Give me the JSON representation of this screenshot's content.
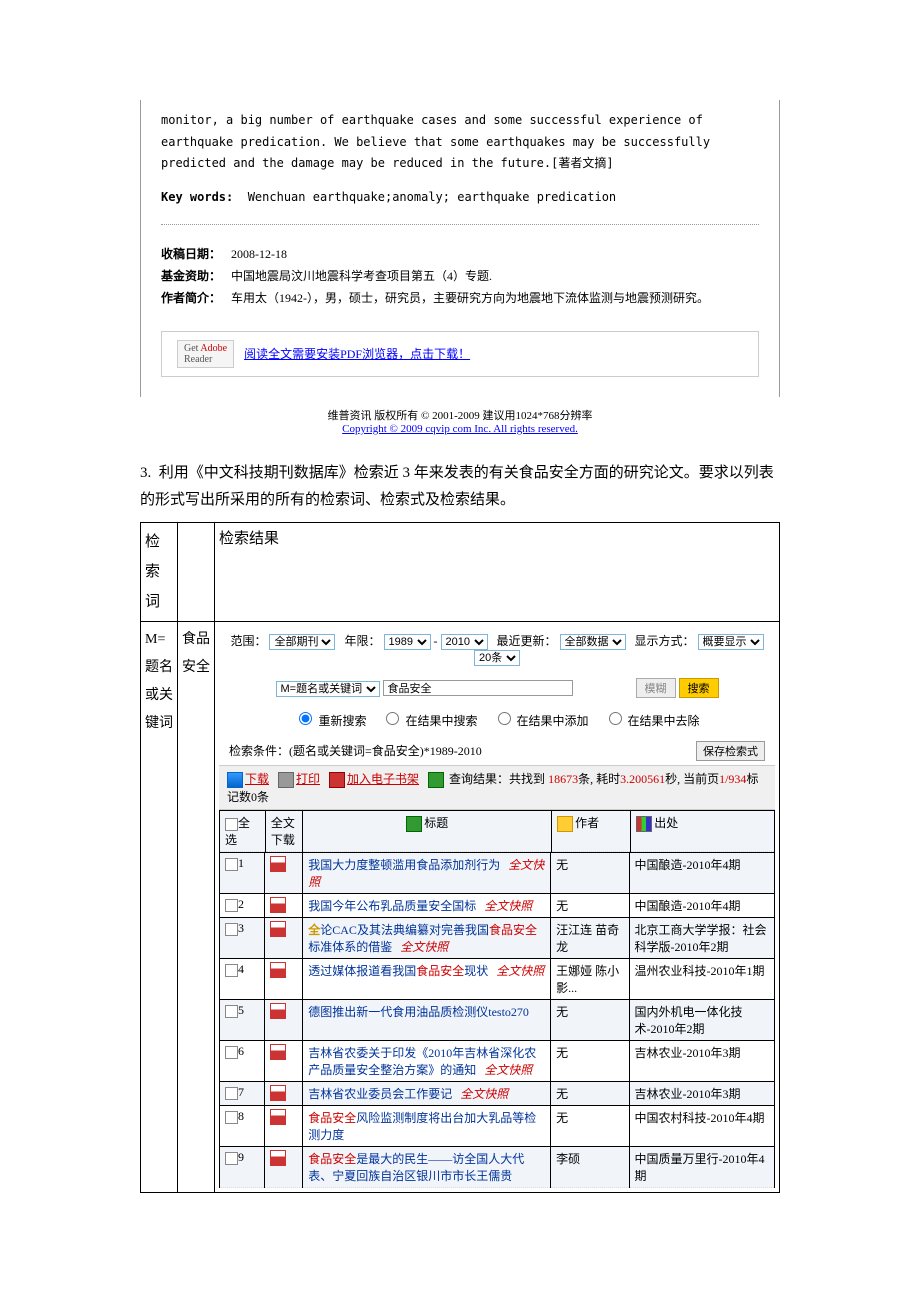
{
  "abstract": "monitor, a big number of earthquake cases and some successful experience of earthquake predication. We believe that some earthquakes may be successfully predicted and the damage may be reduced in the future.[著者文摘]",
  "kw_label": "Key words:",
  "kw_value": "Wenchuan earthquake;anomaly; earthquake predication",
  "meta": {
    "date_label": "收稿日期：",
    "date_value": "2008-12-18",
    "fund_label": "基金资助：",
    "fund_value": "中国地震局汶川地震科学考查项目第五（4）专题.",
    "author_label": "作者简介：",
    "author_value": "车用太（1942-），男，硕士，研究员，主要研究方向为地震地下流体监测与地震预测研究。"
  },
  "reader": {
    "badge_prefix": "Get ",
    "badge_brand": "Adobe",
    "badge_suffix": "Reader",
    "link": "阅读全文需要安装PDF浏览器，点击下载！"
  },
  "footer": {
    "l1": "维普资讯 版权所有 © 2001-2009 建议用1024*768分辨率",
    "l2": "Copyright © 2009 cqvip com Inc. All rights reserved."
  },
  "question": {
    "num": "3.",
    "text": "利用《中文科技期刊数据库》检索近 3 年来发表的有关食品安全方面的研究论文。要求以列表的形式写出所采用的所有的检索词、检索式及检索结果。"
  },
  "tbl": {
    "h1": "检索词",
    "h2": "",
    "h3": "检索结果",
    "r1c1": "M=题名或关键词",
    "r1c2": "食品安全"
  },
  "controls": {
    "range_lbl": "范围：",
    "range_val": "全部期刊",
    "year_lbl": "年限：",
    "year_from": "1989",
    "year_to": "2010",
    "update_lbl": "最近更新：",
    "update_val": "全部数据",
    "display_lbl": "显示方式：",
    "display_val": "概要显示",
    "per_page": "20条",
    "field_val": "M=题名或关键词",
    "kw_val": "食品安全",
    "fuzzy": "模糊",
    "search": "搜索",
    "r1": "重新搜索",
    "r2": "在结果中搜索",
    "r3": "在结果中添加",
    "r4": "在结果中去除",
    "cond_lbl": "检索条件：",
    "cond_val": "(题名或关键词=食品安全)*1989-2010",
    "save": "保存检索式"
  },
  "bar": {
    "download": "下载",
    "print": "打印",
    "shelf": "加入电子书架",
    "res_pre": "查询结果：共找到 ",
    "res_count": "18673",
    "res_mid1": "条, 耗时",
    "res_time": "3.200561",
    "res_mid2": "秒, 当前页",
    "res_page": "1/934",
    "res_sel": "标记数0条"
  },
  "cols": {
    "all": "全选",
    "full": "全文下载",
    "title": "标题",
    "author": "作者",
    "source": "出处"
  },
  "rows": [
    {
      "n": "1",
      "title_pre": "我国大力度整顿滥用食品添加剂行为",
      "kw": "",
      "qw": "全文快照",
      "auth": "无",
      "src": "中国酿造-2010年4期"
    },
    {
      "n": "2",
      "title_pre": "我国今年公布乳品质量安全国标",
      "kw": "",
      "qw": "全文快照",
      "auth": "无",
      "src": "中国酿造-2010年4期"
    },
    {
      "n": "3",
      "title_pre": "论CAC及其法典编纂对完善我国",
      "kw": "食品安全",
      "title_post": "标准体系的借鉴",
      "qw": "全文快照",
      "gold": "全",
      "auth": "汪江连 苗奇龙",
      "src": "北京工商大学学报：社会科学版-2010年2期"
    },
    {
      "n": "4",
      "title_pre": "透过媒体报道看我国",
      "kw": "食品安全",
      "title_post": "现状",
      "qw": "全文快照",
      "auth": "王娜娅 陈小影...",
      "src": "温州农业科技-2010年1期"
    },
    {
      "n": "5",
      "title_pre": "德图推出新一代食用油品质检测仪testo270",
      "kw": "",
      "qw": "",
      "auth": "无",
      "src": "国内外机电一体化技术-2010年2期"
    },
    {
      "n": "6",
      "title_pre": "吉林省农委关于印发《2010年吉林省深化农产品质量安全整治方案》的通知",
      "kw": "",
      "qw": "全文快照",
      "auth": "无",
      "src": "吉林农业-2010年3期"
    },
    {
      "n": "7",
      "title_pre": "吉林省农业委员会工作要记",
      "kw": "",
      "qw": "全文快照",
      "auth": "无",
      "src": "吉林农业-2010年3期"
    },
    {
      "n": "8",
      "title_pre": "",
      "kw": "食品安全",
      "title_post": "风险监测制度将出台加大乳品等检测力度",
      "qw": "",
      "auth": "无",
      "src": "中国农村科技-2010年4期"
    },
    {
      "n": "9",
      "title_pre": "",
      "kw": "食品安全",
      "title_post": "是最大的民生——访全国人大代表、宁夏回族自治区银川市市长王儒贵",
      "qw": "",
      "auth": "李硕",
      "src": "中国质量万里行-2010年4期"
    }
  ]
}
